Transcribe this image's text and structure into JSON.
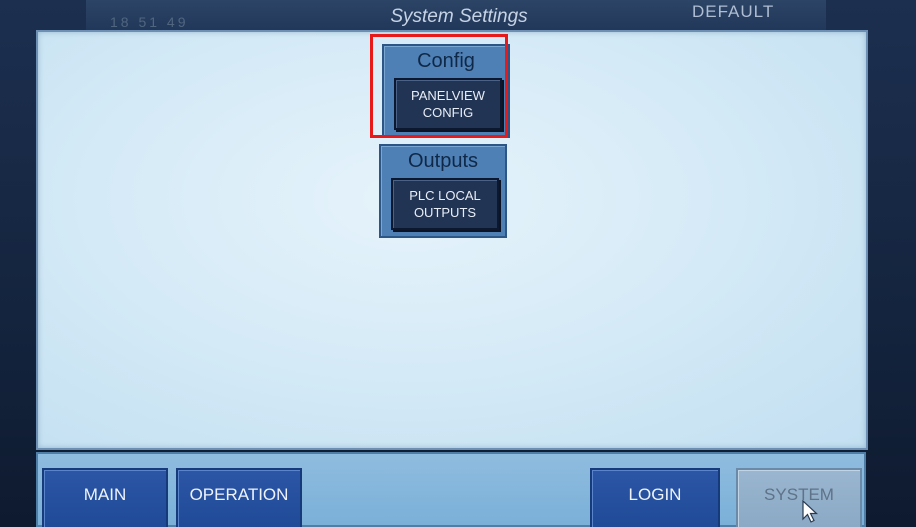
{
  "header": {
    "clock": "18 51 49",
    "title": "System Settings",
    "profile": "DEFAULT"
  },
  "panels": [
    {
      "title": "Config",
      "button_lines": [
        "PANELVIEW",
        "CONFIG"
      ]
    },
    {
      "title": "Outputs",
      "button_lines": [
        "PLC LOCAL",
        "OUTPUTS"
      ]
    }
  ],
  "nav": {
    "main": "MAIN",
    "operation": "OPERATION",
    "login": "LOGIN",
    "system": "SYSTEM"
  },
  "colors": {
    "highlight": "#e81919",
    "nav_button": "#2c56a6",
    "content_bg": "#d6ebf7"
  },
  "icons": {
    "cursor": "mouse-pointer-icon"
  }
}
